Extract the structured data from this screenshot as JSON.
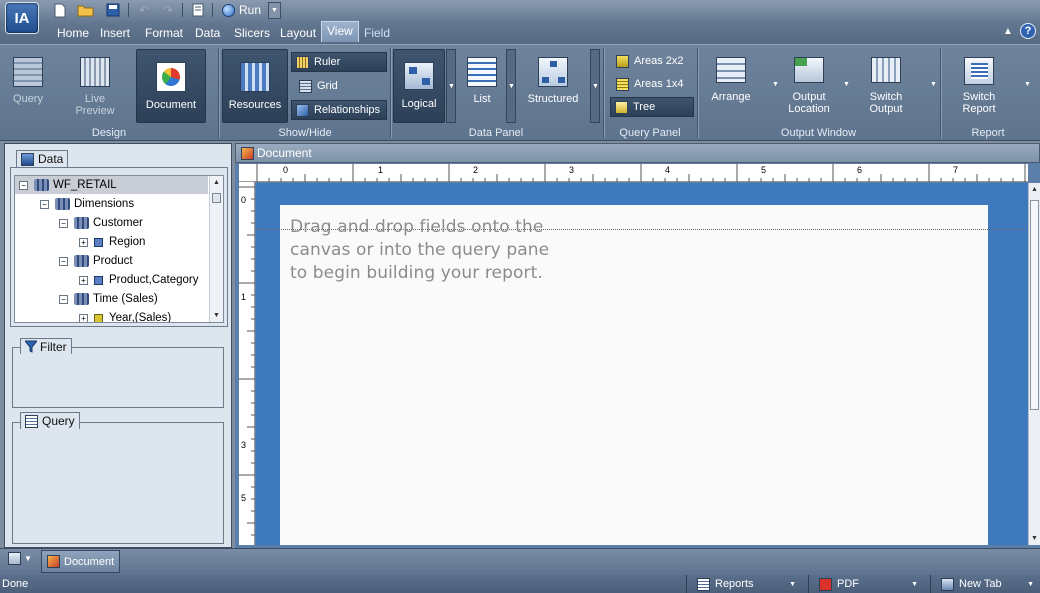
{
  "app": {
    "logo_text": "IA"
  },
  "quick_access": {
    "run_label": "Run"
  },
  "menu_tabs": [
    "Home",
    "Insert",
    "Format",
    "Data",
    "Slicers",
    "Layout",
    "View",
    "Field"
  ],
  "ribbon": {
    "design": {
      "group": "Design",
      "query": "Query",
      "live_preview_1": "Live",
      "live_preview_2": "Preview",
      "document": "Document"
    },
    "show_hide": {
      "group": "Show/Hide",
      "resources": "Resources",
      "ruler": "Ruler",
      "grid": "Grid",
      "relationships": "Relationships"
    },
    "data_panel": {
      "group": "Data Panel",
      "logical": "Logical",
      "list": "List",
      "structured": "Structured"
    },
    "query_panel": {
      "group": "Query Panel",
      "areas_2x2": "Areas 2x2",
      "areas_1x4": "Areas 1x4",
      "tree": "Tree"
    },
    "output_window": {
      "group": "Output Window",
      "arrange": "Arrange",
      "output_location_1": "Output",
      "output_location_2": "Location",
      "switch_output_1": "Switch",
      "switch_output_2": "Output"
    },
    "report": {
      "group": "Report",
      "switch_report_1": "Switch",
      "switch_report_2": "Report"
    }
  },
  "data_panel": {
    "title": "Data",
    "tree": [
      {
        "label": "WF_RETAIL"
      },
      {
        "label": "Dimensions"
      },
      {
        "label": "Customer"
      },
      {
        "label": "Region"
      },
      {
        "label": "Product"
      },
      {
        "label": "Product,Category"
      },
      {
        "label": "Time (Sales)"
      },
      {
        "label": "Year,(Sales)"
      }
    ]
  },
  "filter_panel": {
    "title": "Filter"
  },
  "query_panel": {
    "title": "Query"
  },
  "document": {
    "title": "Document",
    "ruler_h": [
      "0",
      "1",
      "2",
      "3",
      "4",
      "5",
      "6",
      "7"
    ],
    "ruler_v": [
      "0",
      "1",
      "3",
      "5"
    ],
    "hint_lines": [
      "Drag and drop fields onto the",
      "canvas or into the query pane",
      "to begin building your report."
    ]
  },
  "bottom_tab": {
    "label": "Document"
  },
  "status_bar": {
    "status": "Done",
    "reports": "Reports",
    "pdf": "PDF",
    "new_tab": "New Tab"
  },
  "colors": {
    "accent": "#3e78bd",
    "ribbon": "#627690",
    "panel": "#dde5ee"
  }
}
